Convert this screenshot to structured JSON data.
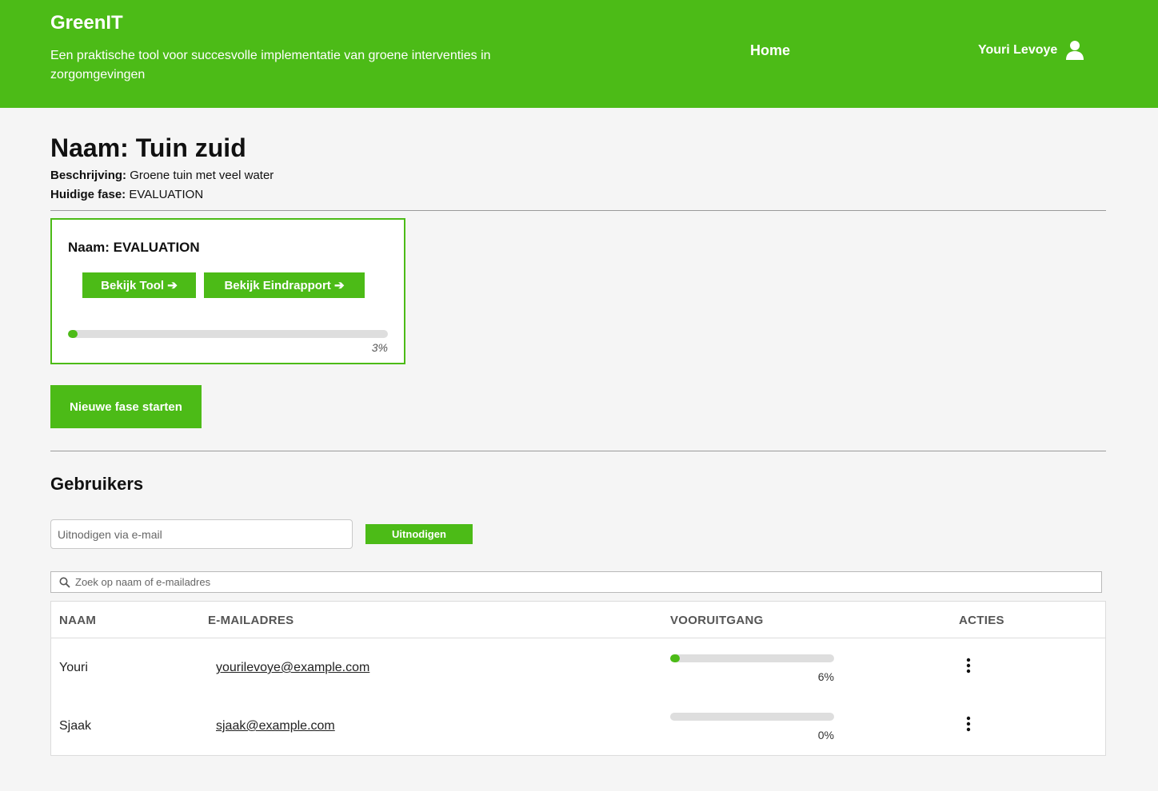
{
  "header": {
    "brand": "GreenIT",
    "tagline": "Een praktische tool voor succesvolle implementatie van groene interventies in zorgomgevingen",
    "nav_home": "Home",
    "user_name": "Youri Levoye",
    "user_icon": "user-icon",
    "accent_color": "#4cbb17"
  },
  "project": {
    "title": "Naam: Tuin zuid",
    "description_label": "Beschrijving:",
    "description_value": "Groene tuin met veel water",
    "phase_label": "Huidige fase:",
    "phase_value": "EVALUATION"
  },
  "phase_card": {
    "name": "Naam: EVALUATION",
    "view_tool_label": "Bekijk Tool ➔",
    "view_report_label": "Bekijk Eindrapport ➔",
    "progress": 3,
    "progress_text": "3%"
  },
  "new_phase_label": "Nieuwe fase starten",
  "users": {
    "title": "Gebruikers",
    "invite_placeholder": "Uitnodigen via e-mail",
    "invite_button": "Uitnodigen",
    "search_placeholder": "Zoek op naam of e-mailadres",
    "columns": [
      "NAAM",
      "E-MAILADRES",
      "VOORUITGANG",
      "ACTIES"
    ],
    "rows": [
      {
        "name": "Youri",
        "email": "yourilevoye@example.com",
        "progress": 6,
        "progress_text": "6%",
        "action_icon": "more-vertical-icon"
      },
      {
        "name": "Sjaak",
        "email": "sjaak@example.com",
        "progress": 0,
        "progress_text": "0%",
        "action_icon": "more-vertical-icon"
      }
    ]
  }
}
